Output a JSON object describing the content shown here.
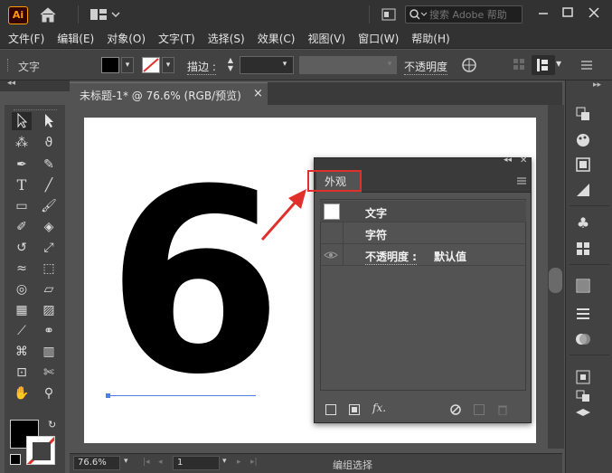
{
  "app": {
    "logo_text": "Ai",
    "search_placeholder": "搜索 Adobe 帮助"
  },
  "menubar": {
    "items": [
      "文件(F)",
      "编辑(E)",
      "对象(O)",
      "文字(T)",
      "选择(S)",
      "效果(C)",
      "视图(V)",
      "窗口(W)",
      "帮助(H)"
    ]
  },
  "controlbar": {
    "type_label": "文字",
    "stroke_label": "描边 :",
    "opacity_label": "不透明度"
  },
  "document": {
    "tab_title": "未标题-1* @ 76.6% (RGB/预览)",
    "close_glyph": "×"
  },
  "canvas": {
    "text": "6"
  },
  "statusbar": {
    "zoom": "76.6%",
    "page": "1",
    "tool_status": "编组选择"
  },
  "appearance_panel": {
    "tab_label": "外观",
    "rows": [
      {
        "label": "文字"
      },
      {
        "label": "字符"
      },
      {
        "label": "不透明度 :",
        "value": "默认值"
      }
    ],
    "fx_label": "fx."
  },
  "colors": {
    "highlight": "#e0302b",
    "accent": "#ff9a00",
    "selection": "#4f7fe6"
  }
}
